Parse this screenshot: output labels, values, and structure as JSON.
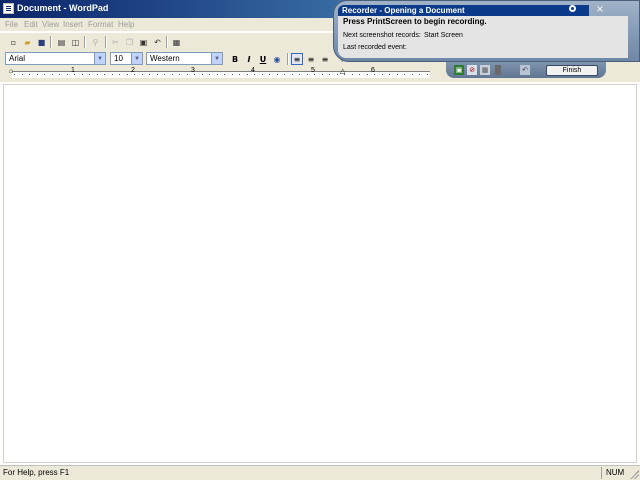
{
  "window": {
    "title": "Document - WordPad"
  },
  "menu": [
    "File",
    "Edit",
    "View",
    "Insert",
    "Format",
    "Help"
  ],
  "toolbar": {
    "icons": [
      "new-icon",
      "open-icon",
      "save-icon",
      "print-icon",
      "print-preview-icon",
      "find-icon",
      "cut-icon",
      "copy-icon",
      "paste-icon",
      "undo-icon",
      "date-time-icon"
    ]
  },
  "format": {
    "font": "Arial",
    "size": "10",
    "script": "Western"
  },
  "ruler": {
    "numbers": [
      "1",
      "2",
      "3",
      "4",
      "5",
      "6"
    ]
  },
  "status": {
    "help": "For Help, press F1",
    "num": "NUM"
  },
  "recorder": {
    "title": "Recorder - Opening a Document",
    "instruction": "Press PrintScreen to begin recording.",
    "next_label": "Next screenshot records:",
    "next_value": "Start Screen",
    "last_label": "Last recorded event:",
    "finish": "Finish"
  },
  "colors": {
    "titlebar": "#0a246a",
    "chrome": "#ece9d8",
    "recorder_title": "#0b3a8a"
  }
}
